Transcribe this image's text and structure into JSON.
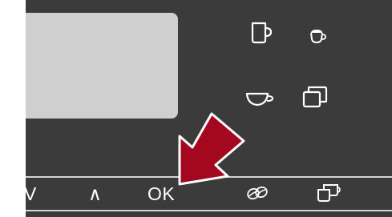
{
  "control_panel": {
    "display": {
      "screen_color": "#cfcfcf"
    },
    "drink_icons": [
      {
        "name": "mug-icon"
      },
      {
        "name": "cappuccino-cup-icon"
      },
      {
        "name": "espresso-cup-icon"
      },
      {
        "name": "double-cup-icon"
      }
    ],
    "bottom_buttons": {
      "down_label": "V",
      "up_label": "∧",
      "ok_label": "OK",
      "bean_icon": "coffee-beans-icon",
      "two_cups_icon": "two-cups-icon"
    }
  },
  "highlight": {
    "color": "#a3081f",
    "target": "OK"
  }
}
